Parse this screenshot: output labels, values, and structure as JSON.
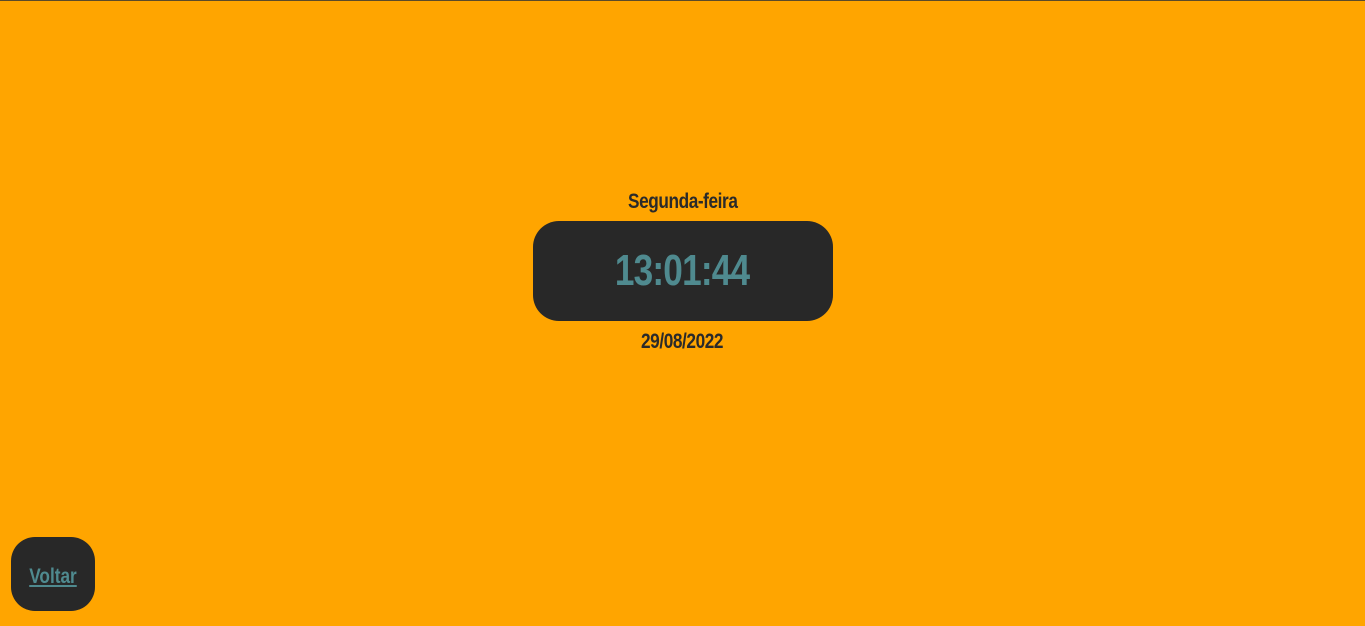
{
  "clock": {
    "weekday": "Segunda-feira",
    "time": "13:01:44",
    "date": "29/08/2022"
  },
  "nav": {
    "back_label": "Voltar"
  },
  "colors": {
    "background": "#ffa500",
    "panel": "#282828",
    "accent": "#4f8a8f",
    "text": "#2a2a2a"
  }
}
